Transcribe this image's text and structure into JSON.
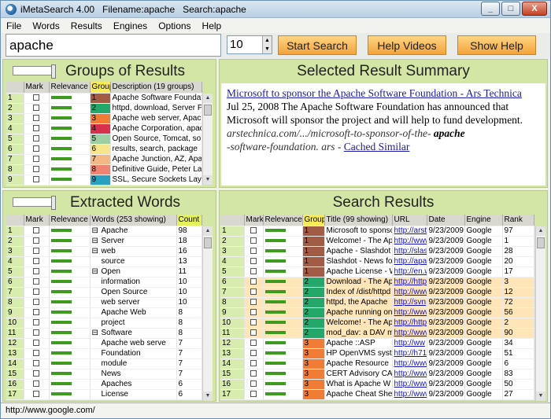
{
  "window": {
    "title": "iMetaSearch 4.00   Filename:apache   Search:apache",
    "min": "_",
    "max": "□",
    "close": "X"
  },
  "menu": [
    "File",
    "Words",
    "Results",
    "Engines",
    "Options",
    "Help"
  ],
  "toolbar": {
    "query": "apache",
    "count": "10",
    "start": "Start Search",
    "videos": "Help Videos",
    "show_help": "Show Help"
  },
  "groups": {
    "title": "Groups of Results",
    "headers": [
      "Mark",
      "Relevance",
      "Group",
      "Description (19 groups)"
    ],
    "rows": [
      {
        "n": "1",
        "g": "1",
        "color": "#a25c45",
        "desc": "Apache Software Foundati"
      },
      {
        "n": "2",
        "g": "2",
        "color": "#23a86a",
        "desc": "httpd, download, Server P"
      },
      {
        "n": "3",
        "g": "3",
        "color": "#f07c36",
        "desc": "Apache web server, Apac"
      },
      {
        "n": "4",
        "g": "4",
        "color": "#d8304c",
        "desc": "Apache Corporation, apac"
      },
      {
        "n": "5",
        "g": "5",
        "color": "#9cd0a3",
        "desc": "Open Source, Tomcat, so"
      },
      {
        "n": "6",
        "g": "6",
        "color": "#f8e48a",
        "desc": "results, search, package"
      },
      {
        "n": "7",
        "g": "7",
        "color": "#f4b887",
        "desc": "Apache Junction, AZ, Apa"
      },
      {
        "n": "8",
        "g": "8",
        "color": "#f08474",
        "desc": "Definitive Guide, Peter La"
      },
      {
        "n": "9",
        "g": "9",
        "color": "#2aa0c0",
        "desc": "SSL, Secure Sockets Lay"
      }
    ]
  },
  "summary": {
    "title": "Selected Result Summary",
    "link": "Microsoft to sponsor the Apache Software Foundation - Ars Technica",
    "text": "Jul 25, 2008 The Apache Software Foundation has announced that Microsoft will sponsor the project and will help to fund development.",
    "url1": "arstechnica.com/.../microsoft-to-sponsor-of-the- ",
    "url_bold": "apache",
    "url2": "-software-foundation. ars - ",
    "cached": "Cached Similar"
  },
  "words": {
    "title": "Extracted Words",
    "headers": [
      "Mark",
      "Relevance",
      "Words (253 showing)",
      "Count"
    ],
    "rows": [
      {
        "n": "1",
        "exp": "⊟",
        "w": "Apache",
        "c": "98"
      },
      {
        "n": "2",
        "exp": "⊟",
        "w": "Server",
        "c": "18"
      },
      {
        "n": "3",
        "exp": "⊟",
        "w": "web",
        "c": "16"
      },
      {
        "n": "4",
        "exp": "",
        "w": "source",
        "c": "13"
      },
      {
        "n": "5",
        "exp": "⊟",
        "w": "Open",
        "c": "11"
      },
      {
        "n": "6",
        "exp": "",
        "w": "information",
        "c": "10"
      },
      {
        "n": "7",
        "exp": "",
        "w": "Open Source",
        "c": "10"
      },
      {
        "n": "8",
        "exp": "",
        "w": "web server",
        "c": "10"
      },
      {
        "n": "9",
        "exp": "",
        "w": "Apache Web",
        "c": "8"
      },
      {
        "n": "10",
        "exp": "",
        "w": "project",
        "c": "8"
      },
      {
        "n": "11",
        "exp": "⊟",
        "w": "Software",
        "c": "8"
      },
      {
        "n": "12",
        "exp": "",
        "w": "Apache web serve",
        "c": "7"
      },
      {
        "n": "13",
        "exp": "",
        "w": "Foundation",
        "c": "7"
      },
      {
        "n": "14",
        "exp": "",
        "w": "module",
        "c": "7"
      },
      {
        "n": "15",
        "exp": "",
        "w": "News",
        "c": "7"
      },
      {
        "n": "16",
        "exp": "",
        "w": "Apaches",
        "c": "6"
      },
      {
        "n": "17",
        "exp": "",
        "w": "License",
        "c": "6"
      }
    ]
  },
  "results": {
    "title": "Search Results",
    "headers": [
      "Mark",
      "Relevance",
      "Group",
      "Title (99 showing)",
      "URL",
      "Date",
      "Engine",
      "Rank"
    ],
    "rows": [
      {
        "n": "1",
        "g": "1",
        "gc": "#a25c45",
        "t": "Microsoft to sponsor",
        "u": "http://arst",
        "d": "9/23/2009",
        "e": "Google",
        "r": "97",
        "hl": false
      },
      {
        "n": "2",
        "g": "1",
        "gc": "#a25c45",
        "t": "Welcome! - The Apa",
        "u": "http://www",
        "d": "9/23/2009",
        "e": "Google",
        "r": "1",
        "hl": false
      },
      {
        "n": "3",
        "g": "1",
        "gc": "#a25c45",
        "t": "Apache - Slashdot",
        "u": "http://slas",
        "d": "9/23/2009",
        "e": "Google",
        "r": "28",
        "hl": false
      },
      {
        "n": "4",
        "g": "1",
        "gc": "#a25c45",
        "t": "Slashdot - News for",
        "u": "http://apa",
        "d": "9/23/2009",
        "e": "Google",
        "r": "20",
        "hl": false
      },
      {
        "n": "5",
        "g": "1",
        "gc": "#a25c45",
        "t": "Apache License - W",
        "u": "http://en.w",
        "d": "9/23/2009",
        "e": "Google",
        "r": "17",
        "hl": false
      },
      {
        "n": "6",
        "g": "2",
        "gc": "#23a86a",
        "t": "Download - The Ap",
        "u": "http://http",
        "d": "9/23/2009",
        "e": "Google",
        "r": "3",
        "hl": true
      },
      {
        "n": "7",
        "g": "2",
        "gc": "#23a86a",
        "t": "Index of /dist/httpd",
        "u": "http://www",
        "d": "9/23/2009",
        "e": "Google",
        "r": "12",
        "hl": true
      },
      {
        "n": "8",
        "g": "2",
        "gc": "#23a86a",
        "t": "httpd, the Apache",
        "u": "http://svn",
        "d": "9/23/2009",
        "e": "Google",
        "r": "72",
        "hl": true
      },
      {
        "n": "9",
        "g": "2",
        "gc": "#23a86a",
        "t": "Apache  running on",
        "u": "http://www",
        "d": "9/23/2009",
        "e": "Google",
        "r": "56",
        "hl": true
      },
      {
        "n": "10",
        "g": "2",
        "gc": "#23a86a",
        "t": "Welcome! - The Apa",
        "u": "http://http",
        "d": "9/23/2009",
        "e": "Google",
        "r": "2",
        "hl": true
      },
      {
        "n": "11",
        "g": "2",
        "gc": "#23a86a",
        "t": "mod_dav: a DAV mo",
        "u": "http://www",
        "d": "9/23/2009",
        "e": "Google",
        "r": "90",
        "hl": true
      },
      {
        "n": "12",
        "g": "3",
        "gc": "#f07c36",
        "t": "Apache ::ASP",
        "u": "http://ww",
        "d": "9/23/2009",
        "e": "Google",
        "r": "34",
        "hl": false
      },
      {
        "n": "13",
        "g": "3",
        "gc": "#f07c36",
        "t": "HP OpenVMS syste",
        "u": "http://h71",
        "d": "9/23/2009",
        "e": "Google",
        "r": "51",
        "hl": false
      },
      {
        "n": "14",
        "g": "3",
        "gc": "#f07c36",
        "t": "Apache  Resource",
        "u": "http://www",
        "d": "9/23/2009",
        "e": "Google",
        "r": "6",
        "hl": false
      },
      {
        "n": "15",
        "g": "3",
        "gc": "#f07c36",
        "t": "CERT Advisory CA-",
        "u": "http://www",
        "d": "9/23/2009",
        "e": "Google",
        "r": "83",
        "hl": false
      },
      {
        "n": "16",
        "g": "3",
        "gc": "#f07c36",
        "t": "What is  Apache  W",
        "u": "http://www",
        "d": "9/23/2009",
        "e": "Google",
        "r": "50",
        "hl": false
      },
      {
        "n": "17",
        "g": "3",
        "gc": "#f07c36",
        "t": "Apache  Cheat She",
        "u": "http://www",
        "d": "9/23/2009",
        "e": "Google",
        "r": "27",
        "hl": false
      }
    ]
  },
  "status": "http://www.google.com/"
}
